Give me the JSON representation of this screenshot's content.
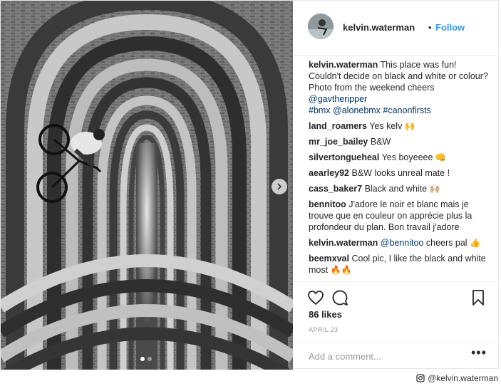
{
  "post": {
    "username": "kelvin.waterman",
    "separator": "•",
    "follow_label": "Follow",
    "carousel": {
      "total": 2,
      "active": 1
    }
  },
  "comments": [
    {
      "user": "kelvin.waterman",
      "text": "This place was fun! Couldn't decide on black and white or colour?",
      "line2": "Photo from the weekend cheers",
      "mention": "@gavtheripper",
      "tags": "#bmx @alonebmx #canonfirsts"
    },
    {
      "user": "land_roamers",
      "text": "Yes kelv",
      "emoji": "🙌"
    },
    {
      "user": "mr_joe_bailey",
      "text": "B&W"
    },
    {
      "user": "silvertongueheal",
      "text": "Yes boyeeee",
      "emoji": "👊"
    },
    {
      "user": "aearley92",
      "text": "B&W looks unreal mate !"
    },
    {
      "user": "cass_baker7",
      "text": "Black and white",
      "emoji": "🙌🏼"
    },
    {
      "user": "bennitoo",
      "text": "J'adore le noir et blanc mais je trouve que en couleur on apprécie plus la profondeur du plan. Bon travail j'adore"
    },
    {
      "user": "kelvin.waterman",
      "mention": "@bennitoo",
      "text": "cheers pal",
      "emoji": "👍"
    },
    {
      "user": "beemxval",
      "text": "Cool pic, I like the black and white most",
      "emoji": "🔥🔥"
    }
  ],
  "actions": {
    "likes": "86 likes",
    "date": "APRIL 23",
    "add_comment_placeholder": "Add a comment...",
    "more_label": "•••"
  },
  "credit": {
    "icon": "instagram-icon",
    "text": "@kelvin.waterman"
  }
}
